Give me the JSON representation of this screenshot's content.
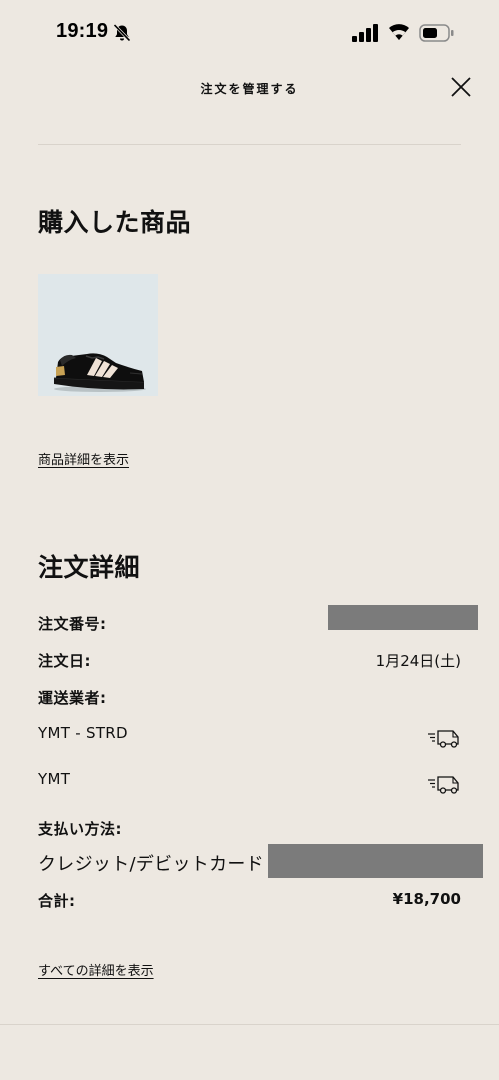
{
  "status_bar": {
    "time": "19:19"
  },
  "header": {
    "title": "注文を管理する"
  },
  "purchased": {
    "title": "購入した商品",
    "product_link": "商品詳細を表示"
  },
  "order_details": {
    "title": "注文詳細",
    "order_number_label": "注文番号:",
    "order_date_label": "注文日:",
    "order_date_value": "1月24日(土)",
    "carrier_label": "運送業者:",
    "carriers": [
      "YMT - STRD",
      "YMT"
    ],
    "payment_label": "支払い方法:",
    "payment_value": "クレジット/デビットカード",
    "total_label": "合計:",
    "total_value": "¥18,700",
    "all_details_link": "すべての詳細を表示"
  }
}
